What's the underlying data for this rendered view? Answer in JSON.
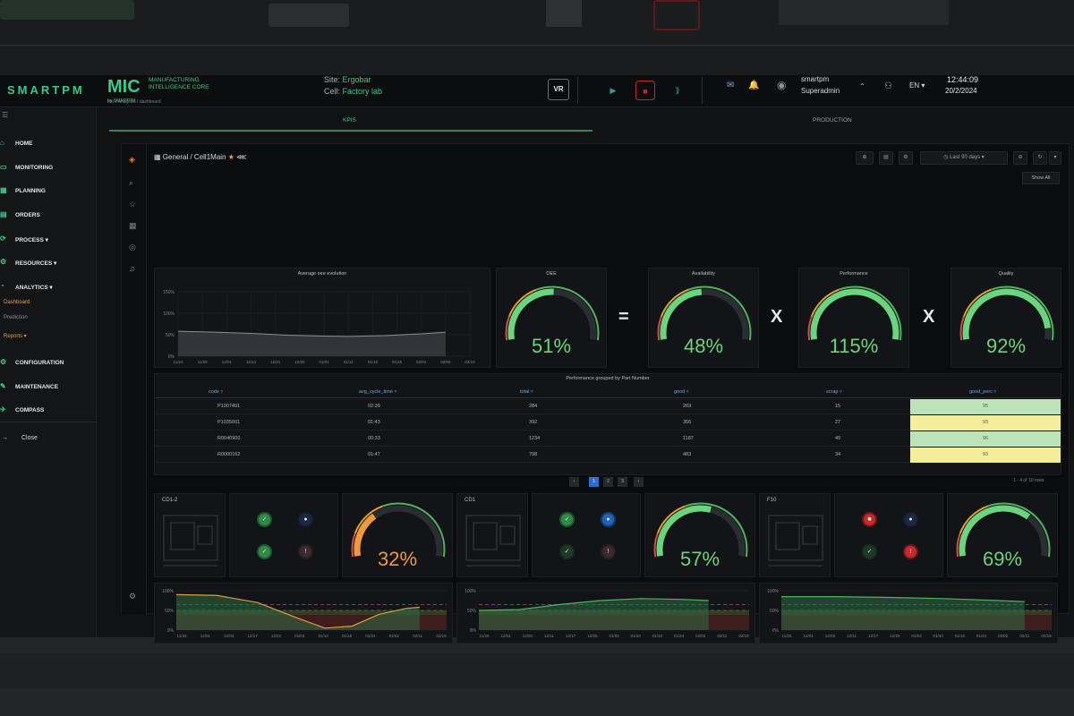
{
  "header": {
    "logo": "SMARTPM",
    "product": "MIC",
    "product_sub": "by SMARTPM",
    "product_desc": "MANUFACTURING INTELLIGENCE CORE",
    "breadcrumb": "mic / Analytics / dashboard",
    "site_label": "Site:",
    "site_value": "Ergobar",
    "cell_label": "Cell:",
    "cell_value": "Factory lab",
    "vr_label": "VR",
    "user_name": "smartpm",
    "user_role": "Superadmin",
    "language": "EN",
    "time": "12:44:09",
    "date": "20/2/2024"
  },
  "sidebar": {
    "items": [
      {
        "label": "HOME",
        "icon": "home-icon"
      },
      {
        "label": "MONITORING",
        "icon": "monitor-icon"
      },
      {
        "label": "PLANNING",
        "icon": "calendar-icon"
      },
      {
        "label": "ORDERS",
        "icon": "orders-icon"
      },
      {
        "label": "PROCESS",
        "icon": "process-icon"
      },
      {
        "label": "RESOURCES",
        "icon": "resources-icon"
      },
      {
        "label": "ANALYTICS",
        "icon": "analytics-icon"
      }
    ],
    "analytics_sub": [
      "Dashboard",
      "Prediction",
      "Reports"
    ],
    "items2": [
      {
        "label": "CONFIGURATION",
        "icon": "gear-icon"
      },
      {
        "label": "MAINTENANCE",
        "icon": "wrench-icon"
      },
      {
        "label": "COMPASS",
        "icon": "compass-icon"
      }
    ],
    "close_label": "Close"
  },
  "tabs": [
    "KPIS",
    "PRODUCTION"
  ],
  "dashboard": {
    "breadcrumb": "General / Cell1Main",
    "time_range": "Last 90 days",
    "show_all": "Show All",
    "trend_title": "Average oee evolution",
    "trend_yticks": [
      "150%",
      "100%",
      "50%",
      "0%"
    ],
    "trend_xticks": [
      "11/23",
      "11/28",
      "12/01",
      "12/14",
      "12/21",
      "12/28",
      "01/04",
      "01/11",
      "01/18",
      "01/25",
      "02/01",
      "02/08",
      "02/15"
    ],
    "oee": {
      "title": "OEE",
      "value": "51%",
      "fraction": 0.51
    },
    "availability": {
      "title": "Availability",
      "value": "48%",
      "fraction": 0.48
    },
    "performance": {
      "title": "Performance",
      "value": "115%",
      "fraction": 1.0
    },
    "quality": {
      "title": "Quality",
      "value": "92%",
      "fraction": 0.92
    },
    "op_equals": "=",
    "op_times": "X",
    "table": {
      "title": "Performance grouped by Part Number",
      "headers": [
        "code",
        "avg_cycle_time",
        "total",
        "good",
        "scrap",
        "good_perc"
      ],
      "rows": [
        [
          "P1007401",
          "02:39",
          "284",
          "269",
          "15",
          "95"
        ],
        [
          "P1035001",
          "01:43",
          "392",
          "356",
          "27",
          "93"
        ],
        [
          "R0040900",
          "00:33",
          "1234",
          "1187",
          "49",
          "96"
        ],
        [
          "R0000162",
          "01:47",
          "798",
          "483",
          "34",
          "93"
        ]
      ],
      "pages": [
        "1",
        "2",
        "3",
        "4"
      ],
      "count": "1 - 4 of 10 rows"
    },
    "machines": [
      {
        "name": "CD1-2",
        "oee": "32%",
        "fraction": 0.32,
        "color": "#ef9a3a"
      },
      {
        "name": "CD1",
        "oee": "57%",
        "fraction": 0.57,
        "color": "#6ad47f"
      },
      {
        "name": "F10",
        "oee": "69%",
        "fraction": 0.69,
        "color": "#6ad47f"
      }
    ],
    "mini_yticks": [
      "100%",
      "50%",
      "0%"
    ],
    "mini_xticks": [
      "11/26",
      "12/01",
      "12/03",
      "12/17",
      "12/22",
      "01/03",
      "01/10",
      "01/18",
      "01/24",
      "02/02",
      "02/11",
      "02/19"
    ],
    "mini_xticks2": [
      "11/26",
      "12/01",
      "12/03",
      "12/11",
      "12/17",
      "12/25",
      "01/03",
      "01/10",
      "01/18",
      "01/24",
      "02/02",
      "02/11",
      "02/19"
    ]
  },
  "colors": {
    "accent": "#3ec78b",
    "gauge_green": "#6ad47f",
    "gauge_orange": "#ef9a3a",
    "gauge_red": "#d94a4a",
    "good_cell_green": "#bde3b8",
    "good_cell_yellow": "#f4ee9a"
  }
}
